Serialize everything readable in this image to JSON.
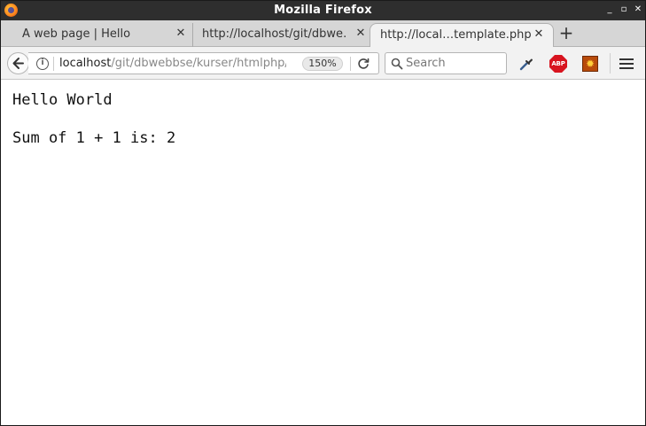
{
  "window": {
    "title": "Mozilla Firefox",
    "controls": {
      "minimize": "_",
      "maximize": "▫",
      "close": "✕"
    }
  },
  "tabs": [
    {
      "label": "A web page | Hello",
      "active": false,
      "close": "✕"
    },
    {
      "label": "http://localhost/git/dbwe…",
      "active": false,
      "close": "✕"
    },
    {
      "label": "http://local…template.php",
      "active": true,
      "close": "✕"
    }
  ],
  "new_tab": "+",
  "navbar": {
    "url_host": "localhost",
    "url_path": "/git/dbwebbse/kurser/htmlphp/e",
    "zoom": "150%",
    "search_placeholder": "Search",
    "abp_text": "ABP"
  },
  "content": {
    "line1": "Hello World",
    "line2": "Sum of 1 + 1 is: 2"
  }
}
